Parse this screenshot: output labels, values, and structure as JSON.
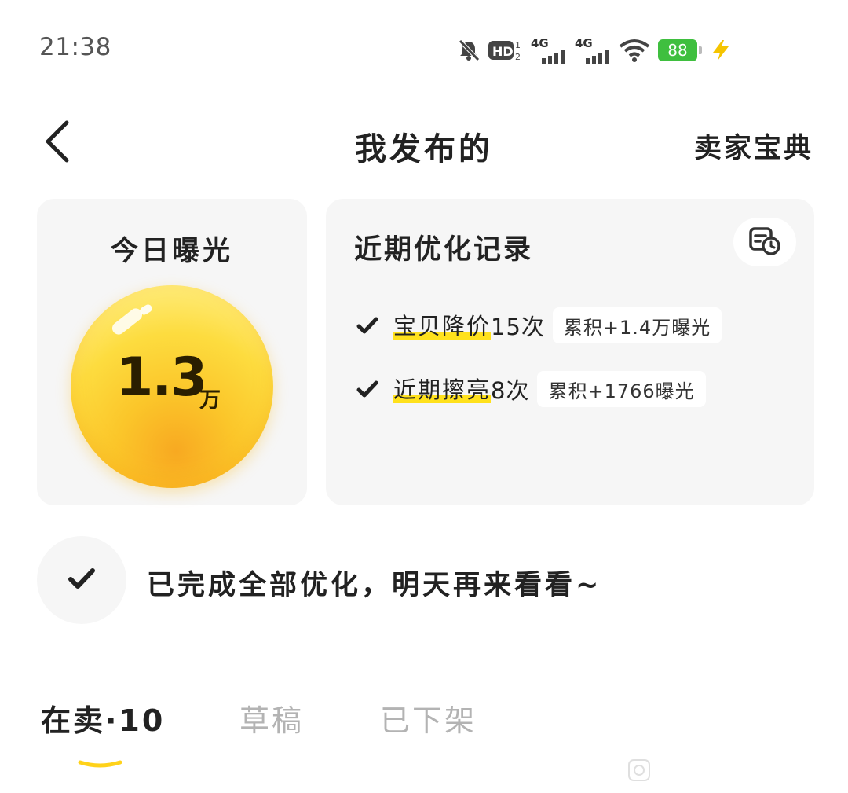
{
  "status_bar": {
    "time": "21:38",
    "network_1": "4G",
    "network_2": "4G",
    "battery": "88",
    "icons": [
      "mute-bell-icon",
      "hd-voice-icon",
      "signal-icon",
      "signal-icon",
      "wifi-icon",
      "battery-icon",
      "charging-bolt-icon"
    ]
  },
  "nav": {
    "back_icon": "chevron-left-icon",
    "title": "我发布的",
    "right_action": "卖家宝典"
  },
  "exposure": {
    "title": "今日曝光",
    "value": "1.3",
    "unit": "万"
  },
  "optimization": {
    "title": "近期优化记录",
    "history_icon": "calendar-clock-icon",
    "items": [
      {
        "name": "宝贝降价",
        "count": "15次",
        "badge": "累积+1.4万曝光"
      },
      {
        "name": "近期擦亮",
        "count": "8次",
        "badge": "累积+1766曝光"
      }
    ]
  },
  "completion": {
    "icon": "check-icon",
    "text": "已完成全部优化，明天再来看看~"
  },
  "tabs": [
    {
      "label": "在卖·10",
      "active": true
    },
    {
      "label": "草稿",
      "active": false
    },
    {
      "label": "已下架",
      "active": false
    }
  ],
  "colors": {
    "accent_yellow": "#ffe11c",
    "card_bg": "#f6f6f6",
    "inactive_tab": "#b3b3b3",
    "battery_green": "#3fbf3f"
  }
}
